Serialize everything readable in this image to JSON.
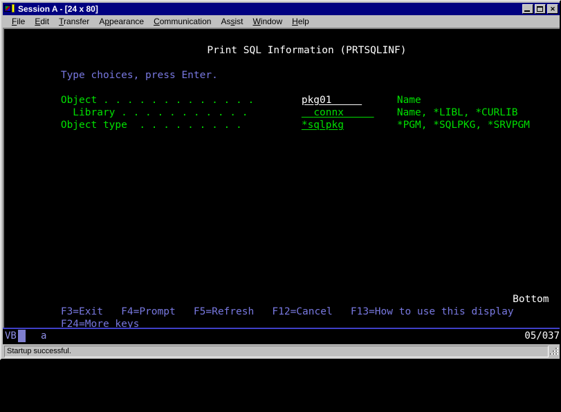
{
  "window": {
    "title": "Session A - [24 x 80]",
    "icon": "terminal-session-icon",
    "buttons": {
      "minimize": "_",
      "maximize": "□",
      "close": "✕"
    }
  },
  "menubar": {
    "items": [
      {
        "label": "File",
        "accel": "F"
      },
      {
        "label": "Edit",
        "accel": "E"
      },
      {
        "label": "Transfer",
        "accel": "T"
      },
      {
        "label": "Appearance",
        "accel": "A"
      },
      {
        "label": "Communication",
        "accel": "C"
      },
      {
        "label": "Assist",
        "accel": "s"
      },
      {
        "label": "Window",
        "accel": "W"
      },
      {
        "label": "Help",
        "accel": "H"
      }
    ]
  },
  "terminal": {
    "screen_title": "Print SQL Information (PRTSQLINF)",
    "instruction": "Type choices, press Enter.",
    "fields": [
      {
        "label": "Object . . . . . . . . . . . . .",
        "value": "pkg01",
        "value_color": "#ffffff",
        "underline_width_chars": 10,
        "help": "Name"
      },
      {
        "label": "  Library . . . . . . . . . . .",
        "value": "connx",
        "value_color": "#00e000",
        "underline_width_chars": 10,
        "help": "Name, *LIBL, *CURLIB"
      },
      {
        "label": "Object type  . . . . . . . . .",
        "value": "*sqlpkg",
        "value_color": "#00e000",
        "underline_width_chars": 10,
        "help": "*PGM, *SQLPKG, *SRVPGM"
      }
    ],
    "more_indicator": "Bottom",
    "function_keys_line1": "F3=Exit   F4=Prompt   F5=Refresh   F12=Cancel   F13=How to use this display",
    "function_keys_line2": "F24=More keys",
    "colors": {
      "background": "#000000",
      "green": "#00e000",
      "white": "#ffffff",
      "blue": "#7878e0"
    }
  },
  "oia": {
    "system_indicator": "VB",
    "insert_indicator": "a",
    "cursor_position": "05/037"
  },
  "statusbar": {
    "message": "Startup successful."
  }
}
